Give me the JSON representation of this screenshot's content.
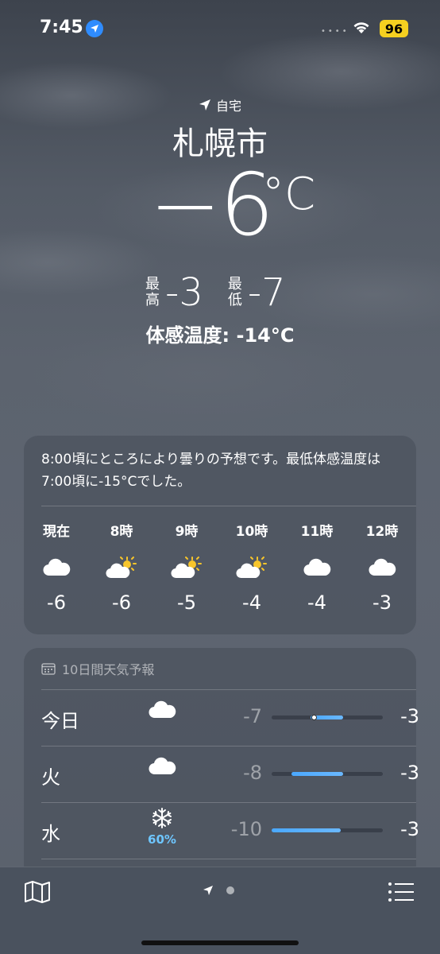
{
  "status": {
    "time": "7:45",
    "battery": "96"
  },
  "hero": {
    "home_label": "自宅",
    "city": "札幌市",
    "temp": "−6",
    "unit": "°C",
    "hi_label": "最高",
    "hi": "-3",
    "lo_label": "最低",
    "lo": "-7",
    "feels": "体感温度: -14°C"
  },
  "hourly": {
    "summary": "8:00頃にところにより曇りの予想です。最低体感温度は7:00頃に-15°Cでした。",
    "items": [
      {
        "label": "現在",
        "icon": "cloud-icon",
        "temp": "-6"
      },
      {
        "label": "8時",
        "icon": "sun-behind-cloud-icon",
        "temp": "-6"
      },
      {
        "label": "9時",
        "icon": "sun-behind-cloud-icon",
        "temp": "-5"
      },
      {
        "label": "10時",
        "icon": "sun-behind-cloud-icon",
        "temp": "-4"
      },
      {
        "label": "11時",
        "icon": "cloud-icon",
        "temp": "-4"
      },
      {
        "label": "12時",
        "icon": "cloud-icon",
        "temp": "-3"
      }
    ]
  },
  "daily": {
    "header": "10日間天気予報",
    "items": [
      {
        "day": "今日",
        "icon": "cloud-icon",
        "low": "-7",
        "high": "-3",
        "bar_start": 0.35,
        "bar_end": 0.64,
        "current": 0.38
      },
      {
        "day": "火",
        "icon": "cloud-icon",
        "low": "-8",
        "high": "-3",
        "bar_start": 0.18,
        "bar_end": 0.64
      },
      {
        "day": "水",
        "icon": "snowflake-icon",
        "precip": "60%",
        "low": "-10",
        "high": "-3",
        "bar_start": 0.0,
        "bar_end": 0.62
      }
    ]
  },
  "colors": {
    "accent": "#2f8cff",
    "battery": "#f5d020",
    "precip": "#6ec6ff"
  }
}
